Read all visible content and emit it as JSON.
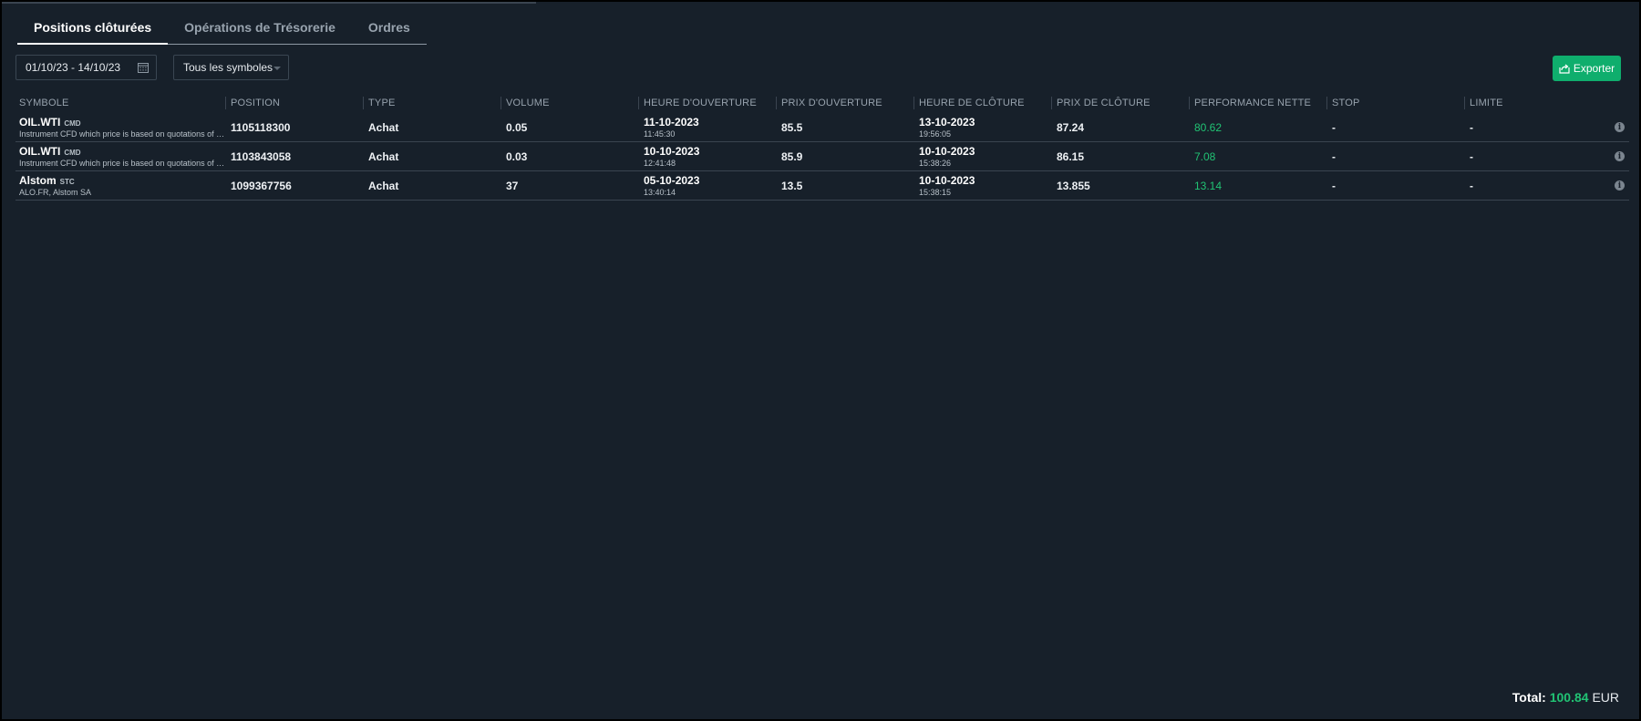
{
  "tabs": [
    {
      "label": "Positions clôturées",
      "active": true
    },
    {
      "label": "Opérations de Trésorerie",
      "active": false
    },
    {
      "label": "Ordres",
      "active": false
    }
  ],
  "filters": {
    "date_range": "01/10/23 - 14/10/23",
    "date_icon": "calendar-icon",
    "symbol_select": "Tous les symboles"
  },
  "export_button": {
    "label": "Exporter",
    "icon": "export-icon",
    "color": "#0fae6d"
  },
  "columns": [
    "SYMBOLE",
    "POSITION",
    "TYPE",
    "VOLUME",
    "HEURE D'OUVERTURE",
    "PRIX D'OUVERTURE",
    "HEURE DE CLÔTURE",
    "PRIX DE CLÔTURE",
    "PERFORMANCE NETTE",
    "STOP",
    "LIMITE"
  ],
  "rows": [
    {
      "symbol": "OIL.WTI",
      "tag": "CMD",
      "description": "Instrument CFD which price is based on quotations of …",
      "position": "1105118300",
      "type": "Achat",
      "volume": "0.05",
      "open_date": "11-10-2023",
      "open_time": "11:45:30",
      "open_price": "85.5",
      "close_date": "13-10-2023",
      "close_time": "19:56:05",
      "close_price": "87.24",
      "performance": "80.62",
      "stop": "-",
      "limit": "-"
    },
    {
      "symbol": "OIL.WTI",
      "tag": "CMD",
      "description": "Instrument CFD which price is based on quotations of …",
      "position": "1103843058",
      "type": "Achat",
      "volume": "0.03",
      "open_date": "10-10-2023",
      "open_time": "12:41:48",
      "open_price": "85.9",
      "close_date": "10-10-2023",
      "close_time": "15:38:26",
      "close_price": "86.15",
      "performance": "7.08",
      "stop": "-",
      "limit": "-"
    },
    {
      "symbol": "Alstom",
      "tag": "STC",
      "description": "ALO.FR, Alstom SA",
      "position": "1099367756",
      "type": "Achat",
      "volume": "37",
      "open_date": "05-10-2023",
      "open_time": "13:40:14",
      "open_price": "13.5",
      "close_date": "10-10-2023",
      "close_time": "15:38:15",
      "close_price": "13.855",
      "performance": "13.14",
      "stop": "-",
      "limit": "-"
    }
  ],
  "total": {
    "label": "Total:",
    "value": "100.84",
    "currency": "EUR"
  },
  "colors": {
    "background": "#17202a",
    "positive": "#21c374",
    "accent": "#0fae6d"
  }
}
